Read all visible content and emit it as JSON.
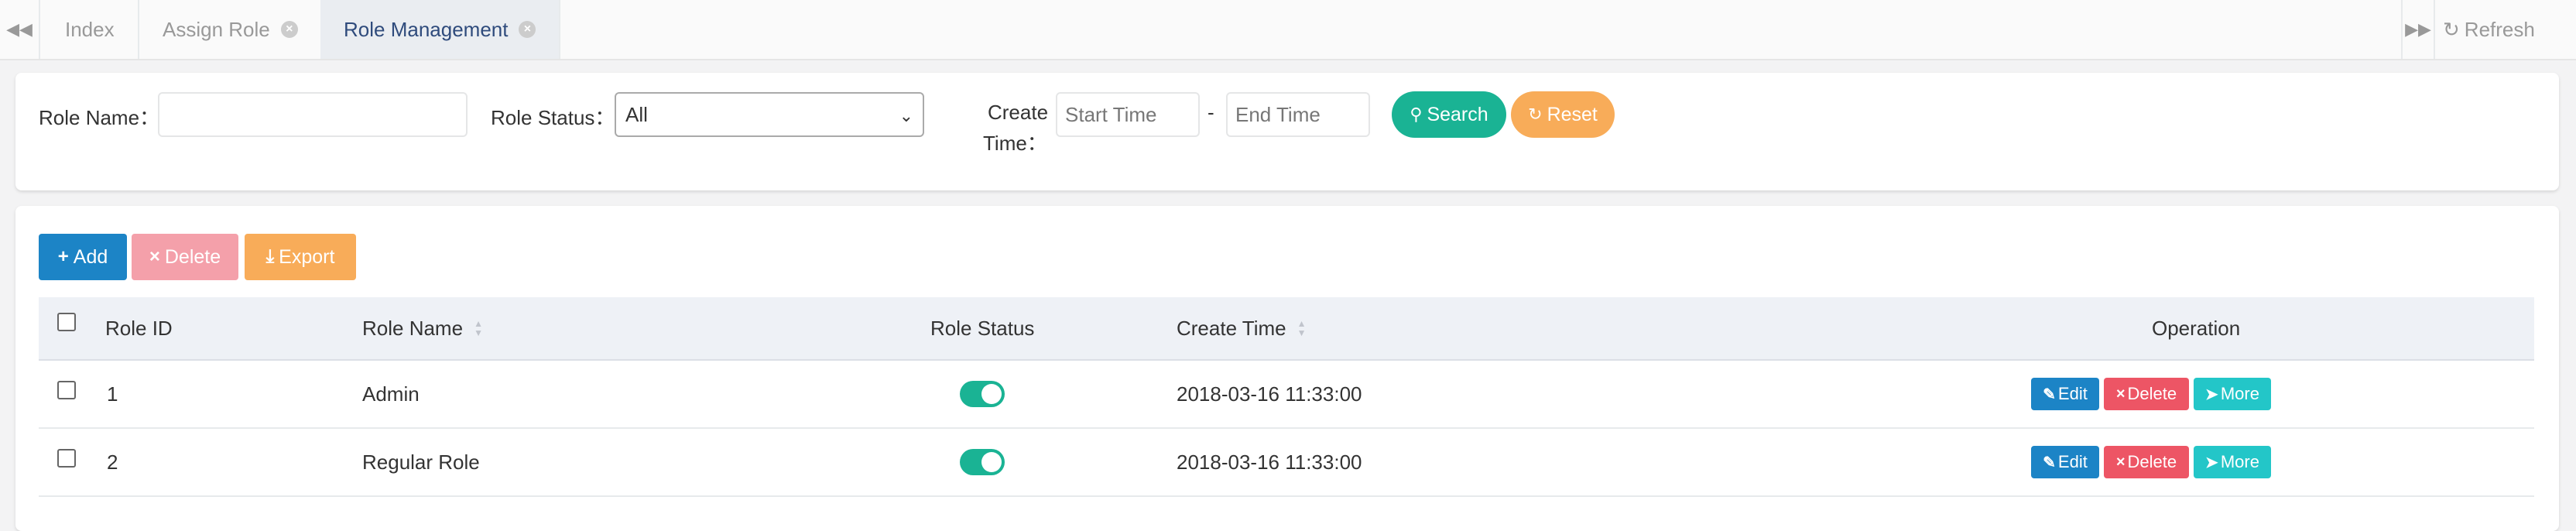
{
  "tabs": {
    "items": [
      {
        "label": "Index"
      },
      {
        "label": "Assign Role"
      },
      {
        "label": "Role Management"
      }
    ],
    "refresh_label": "Refresh"
  },
  "search": {
    "role_name_label": "Role Name：",
    "role_name_value": "",
    "role_status_label": "Role Status：",
    "role_status_selected": "All",
    "create_time_label_1": "Create",
    "create_time_label_2": "Time：",
    "start_time_placeholder": "Start Time",
    "end_time_placeholder": "End Time",
    "range_separator": "-",
    "search_button": "Search",
    "reset_button": "Reset"
  },
  "toolbar": {
    "add_label": "Add",
    "delete_label": "Delete",
    "export_label": "Export"
  },
  "table": {
    "columns": [
      "Role ID",
      "Role Name",
      "Role Status",
      "Create Time",
      "Operation"
    ],
    "rows": [
      {
        "id": "1",
        "name": "Admin",
        "status_on": true,
        "create_time": "2018-03-16 11:33:00"
      },
      {
        "id": "2",
        "name": "Regular Role",
        "status_on": true,
        "create_time": "2018-03-16 11:33:00"
      }
    ],
    "edit_label": "Edit",
    "delete_label": "Delete",
    "more_label": "More"
  },
  "colors": {
    "primary": "#1c84c6",
    "success": "#1ab394",
    "warning": "#f8ac59",
    "danger": "#ed5565",
    "info": "#23c6c8"
  },
  "icons": {
    "tab_left": "double-chevron-left-icon",
    "tab_right": "double-chevron-right-icon",
    "refresh": "refresh-icon",
    "search": "search-icon",
    "reset": "refresh-icon",
    "add": "plus-icon",
    "delete": "times-icon",
    "export": "download-icon",
    "edit": "edit-icon",
    "more": "chevron-circle-right-icon"
  }
}
